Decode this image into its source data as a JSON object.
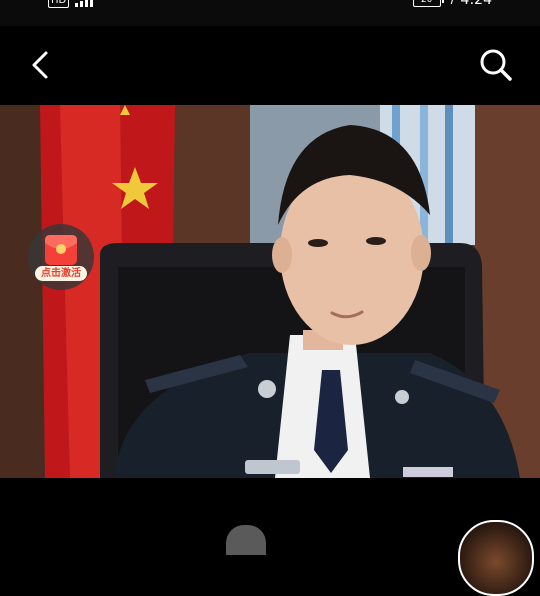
{
  "status_bar": {
    "hd_label": "HD",
    "battery": "20",
    "time": "4:24"
  },
  "nav": {
    "back_icon": "chevron-left-icon",
    "search_icon": "search-icon"
  },
  "promo": {
    "label": "点击激活",
    "icon": "red-envelope-icon"
  },
  "video": {
    "description_icon": "video-frame"
  }
}
